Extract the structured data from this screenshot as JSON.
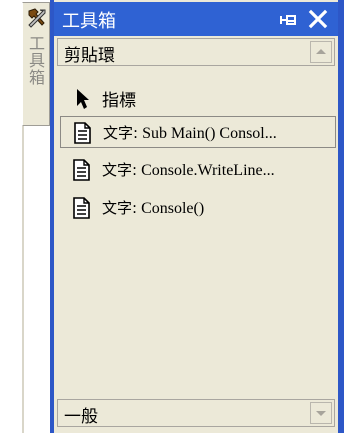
{
  "toolbox": {
    "dock_tab_label": "工具箱",
    "title": "工具箱",
    "pin_icon": "pin-icon",
    "close_icon": "close-icon",
    "clipboard_ring": {
      "label": "剪貼環",
      "items": [
        {
          "label": "指標",
          "icon": "pointer-arrow-icon",
          "selected": false
        },
        {
          "prefix": "文字:",
          "text": " Sub Main() Consol...",
          "icon": "text-document-icon",
          "selected": true
        },
        {
          "prefix": "文字:",
          "text": " Console.WriteLine...",
          "icon": "text-document-icon",
          "selected": false
        },
        {
          "prefix": "文字:",
          "text": "  Console()",
          "icon": "text-document-icon",
          "selected": false
        }
      ]
    },
    "general": {
      "label": "一般"
    }
  },
  "colors": {
    "title_bar": "#2f62d3",
    "panel_background": "#ece9d8",
    "window_border": "#2d57c7"
  }
}
